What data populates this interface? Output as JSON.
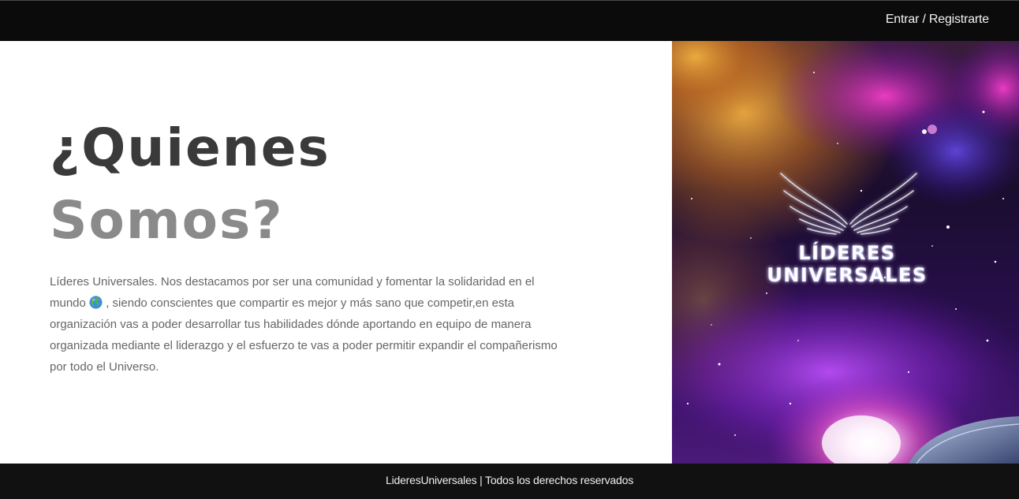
{
  "header": {
    "login_label": "Entrar / Registrarte"
  },
  "about": {
    "title_line1": "¿Quienes",
    "title_line2": "Somos?",
    "description_before_icon": "Líderes Universales. Nos destacamos por ser una comunidad y fomentar la solidaridad en el mundo ",
    "description_after_icon": " , siendo conscientes que compartir es mejor y más sano que competir,en esta organización vas a poder desarrollar tus habilidades dónde aportando en equipo de manera organizada mediante el liderazgo y el esfuerzo te vas a poder permitir expandir el compañerismo por todo el Universo.",
    "inline_icon": "globe-icon"
  },
  "hero": {
    "logo_line1": "LÍDERES",
    "logo_line2": "UNIVERSALES",
    "logo_icon": "wings-icon"
  },
  "footer": {
    "text": "LideresUniversales | Todos los derechos reservados"
  },
  "colors": {
    "topbar": "#0b0b0b",
    "footer": "#111111",
    "title_dark": "#3a3a3a",
    "title_light": "#8a8a8a",
    "body_text": "#666666"
  }
}
